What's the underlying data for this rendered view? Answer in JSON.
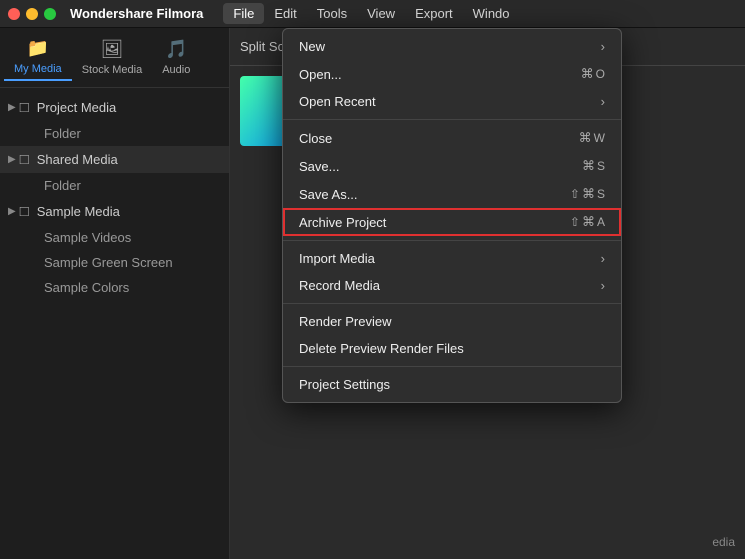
{
  "app": {
    "title": "Wondershare Filmora",
    "menubar": {
      "items": [
        "File",
        "Edit",
        "Tools",
        "View",
        "Export",
        "Windo"
      ]
    }
  },
  "traffic_lights": {
    "close": "close",
    "minimize": "minimize",
    "maximize": "maximize"
  },
  "sidebar": {
    "tabs": [
      {
        "id": "my-media",
        "label": "My Media",
        "icon": "📁",
        "active": true
      },
      {
        "id": "stock-media",
        "label": "Stock Media",
        "icon": "🖼"
      },
      {
        "id": "audio",
        "label": "Audio",
        "icon": "🎵"
      }
    ],
    "tree": [
      {
        "type": "parent",
        "label": "Project Media",
        "expanded": true
      },
      {
        "type": "child",
        "label": "Folder"
      },
      {
        "type": "parent",
        "label": "Shared Media",
        "expanded": true,
        "highlighted": true
      },
      {
        "type": "child",
        "label": "Folder"
      },
      {
        "type": "parent",
        "label": "Sample Media",
        "expanded": true
      },
      {
        "type": "child",
        "label": "Sample Videos"
      },
      {
        "type": "child",
        "label": "Sample Green Screen"
      },
      {
        "type": "child",
        "label": "Sample Colors"
      }
    ]
  },
  "file_menu": {
    "items": [
      {
        "id": "new",
        "label": "New",
        "shortcut": "",
        "has_arrow": true,
        "separator_after": false
      },
      {
        "id": "open",
        "label": "Open...",
        "shortcut": "⌘O",
        "has_arrow": false
      },
      {
        "id": "open-recent",
        "label": "Open Recent",
        "shortcut": "",
        "has_arrow": true
      },
      {
        "id": "sep1",
        "type": "separator"
      },
      {
        "id": "close",
        "label": "Close",
        "shortcut": "⌘W",
        "has_arrow": false
      },
      {
        "id": "save",
        "label": "Save...",
        "shortcut": "⌘S",
        "has_arrow": false
      },
      {
        "id": "save-as",
        "label": "Save As...",
        "shortcut": "⇧⌘S",
        "has_arrow": false
      },
      {
        "id": "archive",
        "label": "Archive Project",
        "shortcut": "⇧⌘A",
        "has_arrow": false,
        "highlighted": true
      },
      {
        "id": "sep2",
        "type": "separator"
      },
      {
        "id": "import-media",
        "label": "Import Media",
        "shortcut": "",
        "has_arrow": true
      },
      {
        "id": "record-media",
        "label": "Record Media",
        "shortcut": "",
        "has_arrow": true
      },
      {
        "id": "sep3",
        "type": "separator"
      },
      {
        "id": "render-preview",
        "label": "Render Preview",
        "shortcut": "",
        "has_arrow": false
      },
      {
        "id": "delete-preview",
        "label": "Delete Preview Render Files",
        "shortcut": "",
        "has_arrow": false
      },
      {
        "id": "sep4",
        "type": "separator"
      },
      {
        "id": "project-settings",
        "label": "Project Settings",
        "shortcut": "",
        "has_arrow": false
      }
    ]
  },
  "right_panel": {
    "split_screen_label": "Split Scre",
    "media_label": "edia"
  }
}
